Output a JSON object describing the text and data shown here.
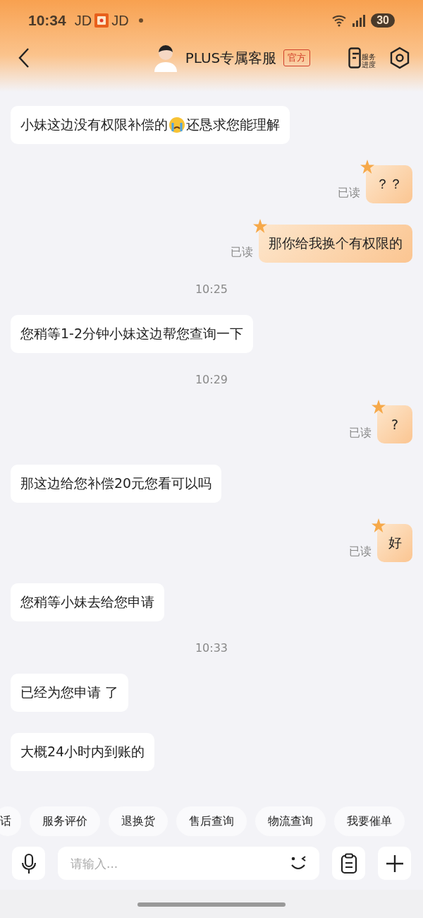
{
  "status_bar": {
    "time": "10:34",
    "apps": [
      "JD",
      "JD"
    ],
    "battery": "30"
  },
  "header": {
    "title": "PLUS专属客服",
    "badge": "官方",
    "progress_label": "服务进度"
  },
  "messages": [
    {
      "kind": "incoming",
      "parts": [
        {
          "kind": "text",
          "text": "小妹这边没有权限补偿的"
        },
        {
          "kind": "emoji"
        },
        {
          "kind": "text",
          "text": "还恳求您能理解"
        }
      ]
    },
    {
      "kind": "outgoing",
      "text": "？？",
      "status": "已读"
    },
    {
      "kind": "outgoing",
      "text": "那你给我换个有权限的",
      "status": "已读"
    },
    {
      "kind": "time",
      "text": "10:25"
    },
    {
      "kind": "incoming",
      "parts": [
        {
          "kind": "text",
          "text": "您稍等1-2分钟小妹这边帮您查询一下"
        }
      ]
    },
    {
      "kind": "time",
      "text": "10:29"
    },
    {
      "kind": "outgoing",
      "text": "?",
      "status": "已读"
    },
    {
      "kind": "incoming",
      "parts": [
        {
          "kind": "text",
          "text": "那这边给您补偿20元您看可以吗"
        }
      ]
    },
    {
      "kind": "outgoing",
      "text": "好",
      "status": "已读"
    },
    {
      "kind": "incoming",
      "parts": [
        {
          "kind": "text",
          "text": "您稍等小妹去给您申请"
        }
      ]
    },
    {
      "kind": "time",
      "text": "10:33"
    },
    {
      "kind": "incoming",
      "parts": [
        {
          "kind": "text",
          "text": "已经为您申请 了"
        }
      ]
    },
    {
      "kind": "incoming",
      "parts": [
        {
          "kind": "text",
          "text": "大概24小时内到账的"
        }
      ]
    }
  ],
  "quick_replies": [
    "话",
    "服务评价",
    "退换货",
    "售后查询",
    "物流查询",
    "我要催单"
  ],
  "input": {
    "placeholder": "请输入..."
  }
}
